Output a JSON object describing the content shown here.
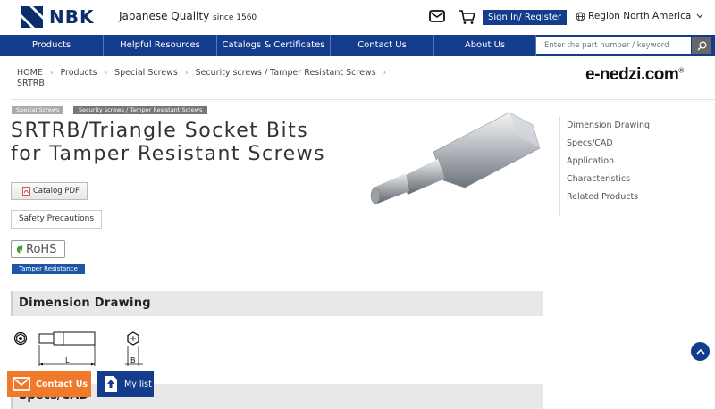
{
  "header": {
    "brand": "NBK",
    "tagline": "Japanese Quality",
    "tagline_since": "since 1560",
    "signin_label": "Sign In/ Register",
    "region_label": "Region North America",
    "icons": [
      "nbk-logo-icon",
      "mail-icon",
      "cart-icon",
      "globe-icon",
      "chevron-down-icon"
    ]
  },
  "nav": {
    "items": [
      {
        "label": "Products"
      },
      {
        "label": "Helpful Resources"
      },
      {
        "label": "Catalogs & Certificates"
      },
      {
        "label": "Contact Us"
      },
      {
        "label": "About Us"
      }
    ],
    "search_placeholder": "Enter the part number / keyword"
  },
  "breadcrumb": {
    "items": [
      "HOME",
      "Products",
      "Special Screws",
      "Security screws / Tamper Resistant Screws"
    ],
    "current": "SRTRB"
  },
  "partner_logo": "e-nedzi.com",
  "partner_logo_mark": "®",
  "product": {
    "tags": [
      "Special Screws",
      "Security screws / Tamper Resistant Screws"
    ],
    "title_line1": "SRTRB/Triangle Socket Bits",
    "title_line2": "for Tamper Resistant Screws",
    "catalog_label": "Catalog PDF",
    "safety_label": "Safety Precautions",
    "rohs_label": "RoHS",
    "feature_badge": "Tamper Resistance"
  },
  "sidebar": {
    "links": [
      "Dimension Drawing",
      "Specs/CAD",
      "Application",
      "Characteristics",
      "Related Products"
    ]
  },
  "sections": {
    "dimension_title": "Dimension Drawing",
    "specs_title": "Specs/CAD",
    "drawing_label_l": "L",
    "drawing_label_b": "B"
  },
  "floating": {
    "contact_label": "Contact Us",
    "mylist_label": "My list"
  },
  "colors": {
    "navy": "#143c8c",
    "orange": "#f07a2a",
    "badge_blue": "#1f57a8"
  }
}
